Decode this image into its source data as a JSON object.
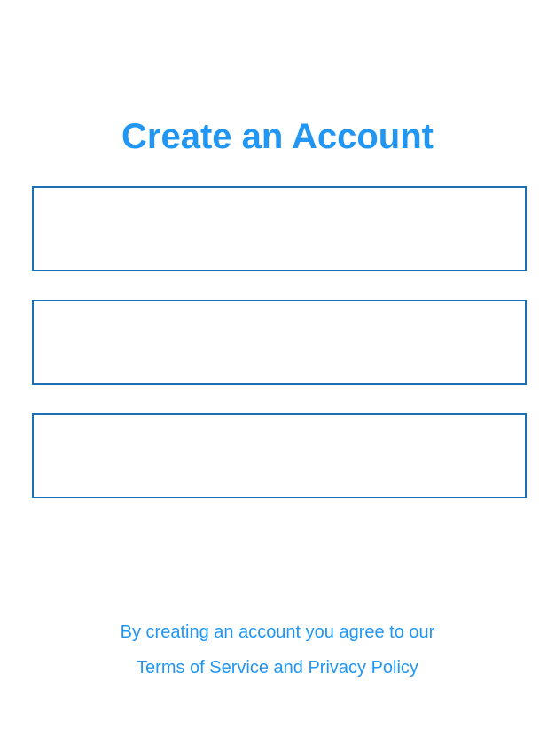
{
  "page": {
    "title": "Create an Account"
  },
  "form": {
    "fields": [
      {
        "value": "",
        "placeholder": ""
      },
      {
        "value": "",
        "placeholder": ""
      },
      {
        "value": "",
        "placeholder": ""
      }
    ]
  },
  "footer": {
    "agreement_text": "By creating an account you agree to our",
    "terms_link": "Terms of Service and Privacy Policy"
  },
  "colors": {
    "accent": "#2196f3",
    "field_border": "#1f6fb4",
    "background": "#ffffff"
  }
}
